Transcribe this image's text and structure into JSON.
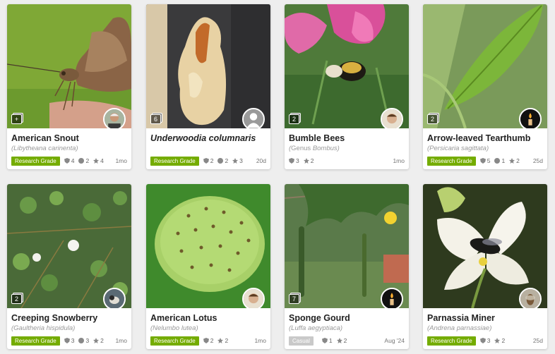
{
  "colors": {
    "research": "#74ac00",
    "casual": "#c9c9c9",
    "background": "#eeeeee"
  },
  "cards": [
    {
      "name": "American Snout",
      "sci": "Libytheana carinenta",
      "sci_prefix": "",
      "count": "+",
      "grade": "Research Grade",
      "ids": "4",
      "comments": "2",
      "faves": "4",
      "date": "1mo",
      "avatar": "person"
    },
    {
      "name": "Underwoodia columnaris",
      "sci": "",
      "sci_prefix": "",
      "count": "6",
      "grade": "Research Grade",
      "ids": "2",
      "comments": "2",
      "faves": "3",
      "date": "20d",
      "avatar": "default"
    },
    {
      "name": "Bumble Bees",
      "sci": "Bombus",
      "sci_prefix": "Genus ",
      "count": "2",
      "grade": "",
      "ids": "3",
      "comments": "",
      "faves": "2",
      "date": "1mo",
      "avatar": "person"
    },
    {
      "name": "Arrow-leaved Tearthumb",
      "sci": "Persicaria sagittata",
      "sci_prefix": "",
      "count": "2",
      "grade": "Research Grade",
      "ids": "5",
      "comments": "1",
      "faves": "2",
      "date": "25d",
      "avatar": "candle"
    },
    {
      "name": "Creeping Snowberry",
      "sci": "Gaultheria hispidula",
      "sci_prefix": "",
      "count": "2",
      "grade": "Research Grade",
      "ids": "3",
      "comments": "3",
      "faves": "2",
      "date": "1mo",
      "avatar": "bird"
    },
    {
      "name": "American Lotus",
      "sci": "Nelumbo lutea",
      "sci_prefix": "",
      "count": "",
      "grade": "Research Grade",
      "ids": "2",
      "comments": "",
      "faves": "2",
      "date": "1mo",
      "avatar": "person"
    },
    {
      "name": "Sponge Gourd",
      "sci": "Luffa aegyptiaca",
      "sci_prefix": "",
      "count": "7",
      "grade": "Casual",
      "ids": "1",
      "comments": "",
      "faves": "2",
      "date": "Aug '24",
      "avatar": "candle"
    },
    {
      "name": "Parnassia Miner",
      "sci": "Andrena parnassiae",
      "sci_prefix": "",
      "count": "",
      "grade": "Research Grade",
      "ids": "3",
      "comments": "",
      "faves": "2",
      "date": "25d",
      "avatar": "bee"
    }
  ]
}
